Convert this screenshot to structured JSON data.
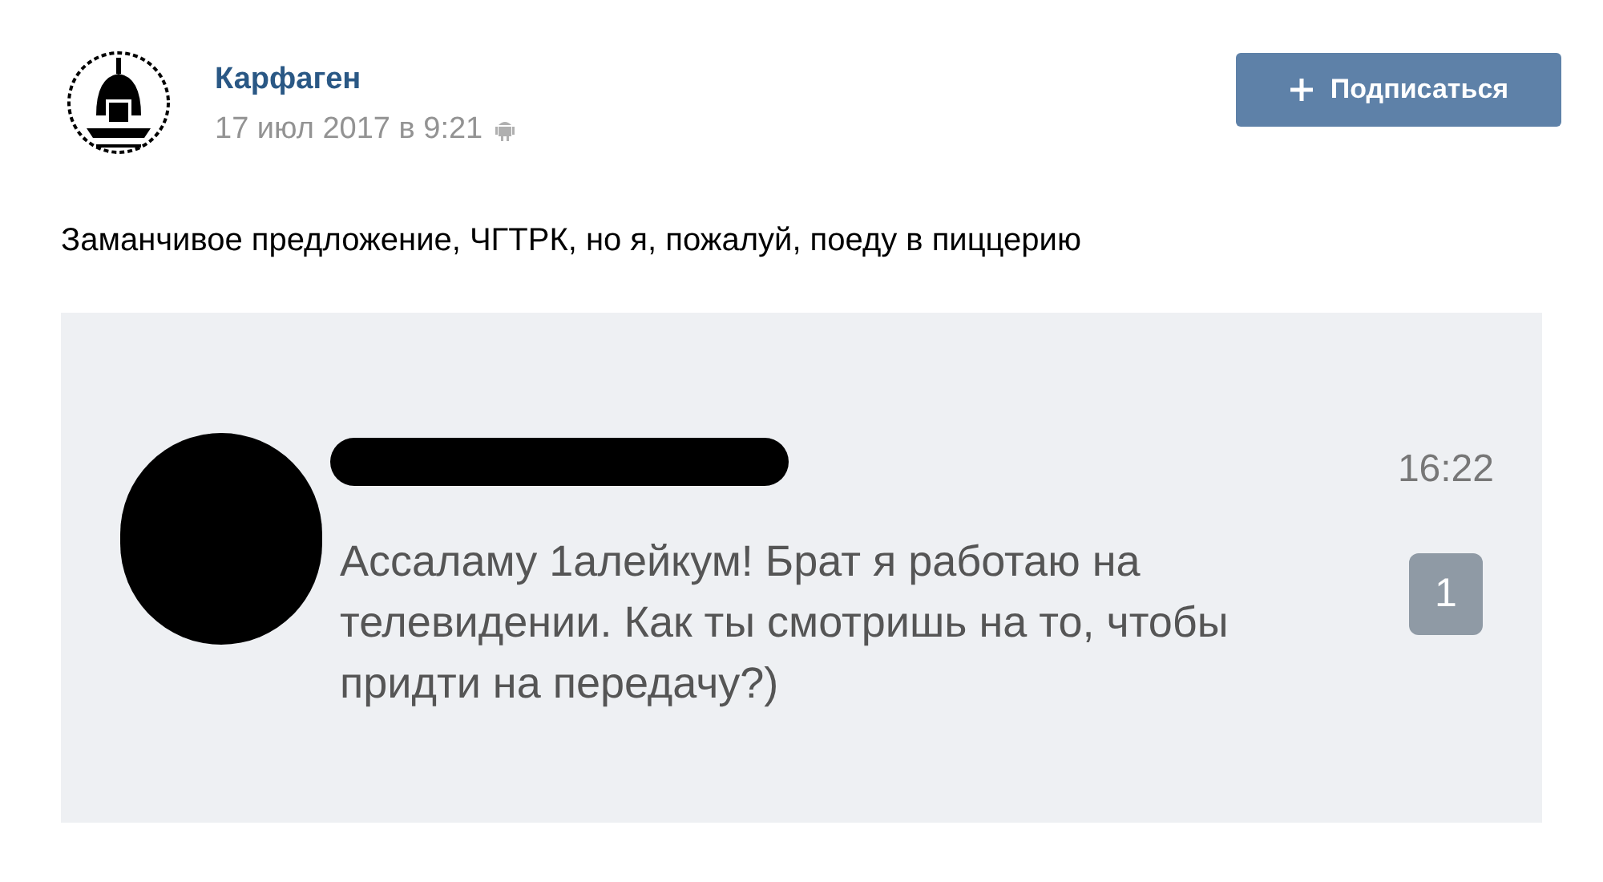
{
  "post": {
    "author": "Карфаген",
    "date": "17 июл 2017 в 9:21",
    "subscribe_button": "Подписаться",
    "text": "Заманчивое предложение, ЧГТРК, но я, пожалуй, поеду в пиццерию"
  },
  "screenshot": {
    "time": "16:22",
    "message": "Ассаламу 1алейкум! Брат я работаю на телевидении. Как ты смотришь на то, чтобы придти на передачу?)",
    "unread_count": "1"
  }
}
